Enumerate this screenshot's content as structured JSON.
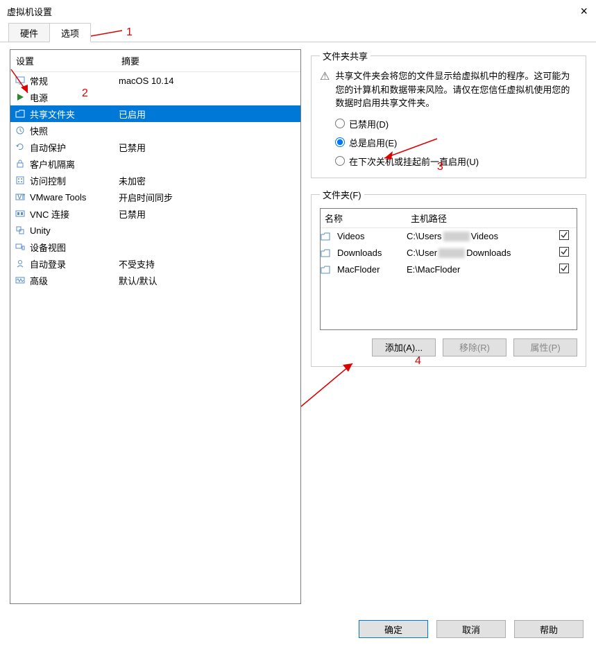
{
  "window": {
    "title": "虚拟机设置"
  },
  "tabs": {
    "hardware": "硬件",
    "options": "选项"
  },
  "list": {
    "col_device": "设置",
    "col_summary": "摘要",
    "rows": [
      {
        "icon": "monitor-icon",
        "label": "常规",
        "summary": "macOS 10.14"
      },
      {
        "icon": "play-icon",
        "label": "电源",
        "summary": ""
      },
      {
        "icon": "folder-icon",
        "label": "共享文件夹",
        "summary": "已启用",
        "selected": true
      },
      {
        "icon": "clock-icon",
        "label": "快照",
        "summary": ""
      },
      {
        "icon": "refresh-icon",
        "label": "自动保护",
        "summary": "已禁用"
      },
      {
        "icon": "lock-icon",
        "label": "客户机隔离",
        "summary": ""
      },
      {
        "icon": "keypad-icon",
        "label": "访问控制",
        "summary": "未加密"
      },
      {
        "icon": "vm-icon",
        "label": "VMware Tools",
        "summary": "开启时间同步"
      },
      {
        "icon": "vnc-icon",
        "label": "VNC 连接",
        "summary": "已禁用"
      },
      {
        "icon": "unity-icon",
        "label": "Unity",
        "summary": ""
      },
      {
        "icon": "device-icon",
        "label": "设备视图",
        "summary": ""
      },
      {
        "icon": "person-icon",
        "label": "自动登录",
        "summary": "不受支持"
      },
      {
        "icon": "wave-icon",
        "label": "高级",
        "summary": "默认/默认"
      }
    ]
  },
  "sharing": {
    "legend": "文件夹共享",
    "warning": "共享文件夹会将您的文件显示给虚拟机中的程序。这可能为您的计算机和数据带来风险。请仅在您信任虚拟机使用您的数据时启用共享文件夹。",
    "opt_disabled": "已禁用(D)",
    "opt_always": "总是启用(E)",
    "opt_until": "在下次关机或挂起前一直启用(U)"
  },
  "folders": {
    "legend": "文件夹(F)",
    "col_name": "名称",
    "col_path": "主机路径",
    "rows": [
      {
        "name": "Videos",
        "path_pre": "C:\\Users",
        "path_post": "Videos"
      },
      {
        "name": "Downloads",
        "path_pre": "C:\\User",
        "path_post": "Downloads"
      },
      {
        "name": "MacFloder",
        "path_full": "E:\\MacFloder"
      }
    ],
    "btn_add": "添加(A)...",
    "btn_remove": "移除(R)",
    "btn_props": "属性(P)"
  },
  "dialog_buttons": {
    "ok": "确定",
    "cancel": "取消",
    "help": "帮助"
  },
  "annotations": {
    "a1": "1",
    "a2": "2",
    "a3": "3",
    "a4": "4"
  }
}
